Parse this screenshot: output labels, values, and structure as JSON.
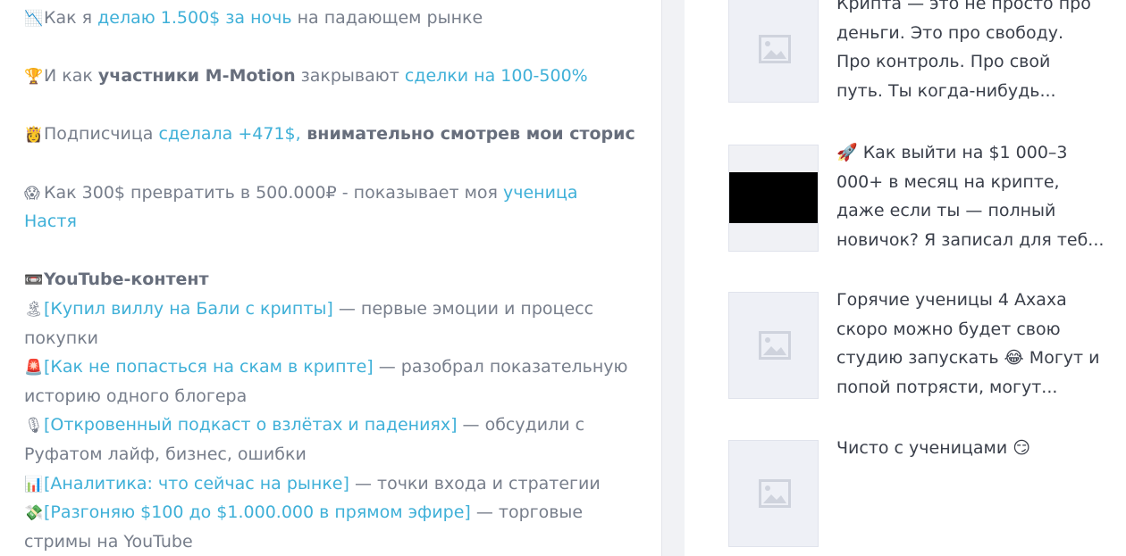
{
  "left": {
    "lines": [
      {
        "emoji": "📉",
        "pre": "Как я ",
        "link": "делаю 1.500$ за ночь",
        "post": " на падающем рынке"
      },
      {
        "emoji": "🏆",
        "pre": "И как ",
        "bold": "участники M-Motion",
        "mid": " закрывают ",
        "link": "сделки на 100-500%"
      },
      {
        "emoji": "👸",
        "pre": "Подписчица ",
        "link": "сделала +471$,",
        "bold": " внимательно смотрев мои сторис"
      },
      {
        "emoji": "😱",
        "pre": "Как 300$ превратить в 500.000₽ - показывает моя ",
        "link": "ученица",
        "link2": "Настя"
      },
      {
        "emoji": "📼",
        "bold": "YouTube-контент"
      },
      {
        "emoji": "🏝",
        "link": "[Купил виллу на Бали с крипты]",
        "post": " — первые эмоции и процесс",
        "cont": "покупки"
      },
      {
        "emoji": "🚨",
        "link": "[Как не попасться на скам в крипте]",
        "post": " — разобрал показательную",
        "cont": "историю одного блогера"
      },
      {
        "emoji": "🎙",
        "link": "[Откровенный подкаст о взлётах и падениях]",
        "post": " — обсудили с",
        "cont": "Руфатом лайф, бизнес, ошибки"
      },
      {
        "emoji": "📊",
        "link": "[Аналитика: что сейчас на рынке]",
        "post": " — точки входа и стратегии"
      },
      {
        "emoji": "💸",
        "link": "[Разгоняю $100 до $1.000.000 в прямом эфире]",
        "post": " — торговые",
        "cont": "стримы на YouTube"
      }
    ]
  },
  "posts": [
    {
      "lines": [
        "Крипта — это не просто про",
        "деньги. Это про свободу.",
        "Про контроль. Про свой",
        "путь. Ты когда-нибудь..."
      ]
    },
    {
      "lines": [
        "🚀  Как выйти на $1 000–3",
        "000+ в месяц на крипте,",
        "даже если ты — полный",
        "новичок? Я записал для теб..."
      ]
    },
    {
      "lines": [
        "Горячие ученицы 4 Ахаха",
        "скоро можно будет свою",
        "студию запускать 😂 Могут и",
        "попой потрясти, могут..."
      ]
    },
    {
      "lines": [
        "Чисто с ученицами 😏"
      ]
    }
  ]
}
